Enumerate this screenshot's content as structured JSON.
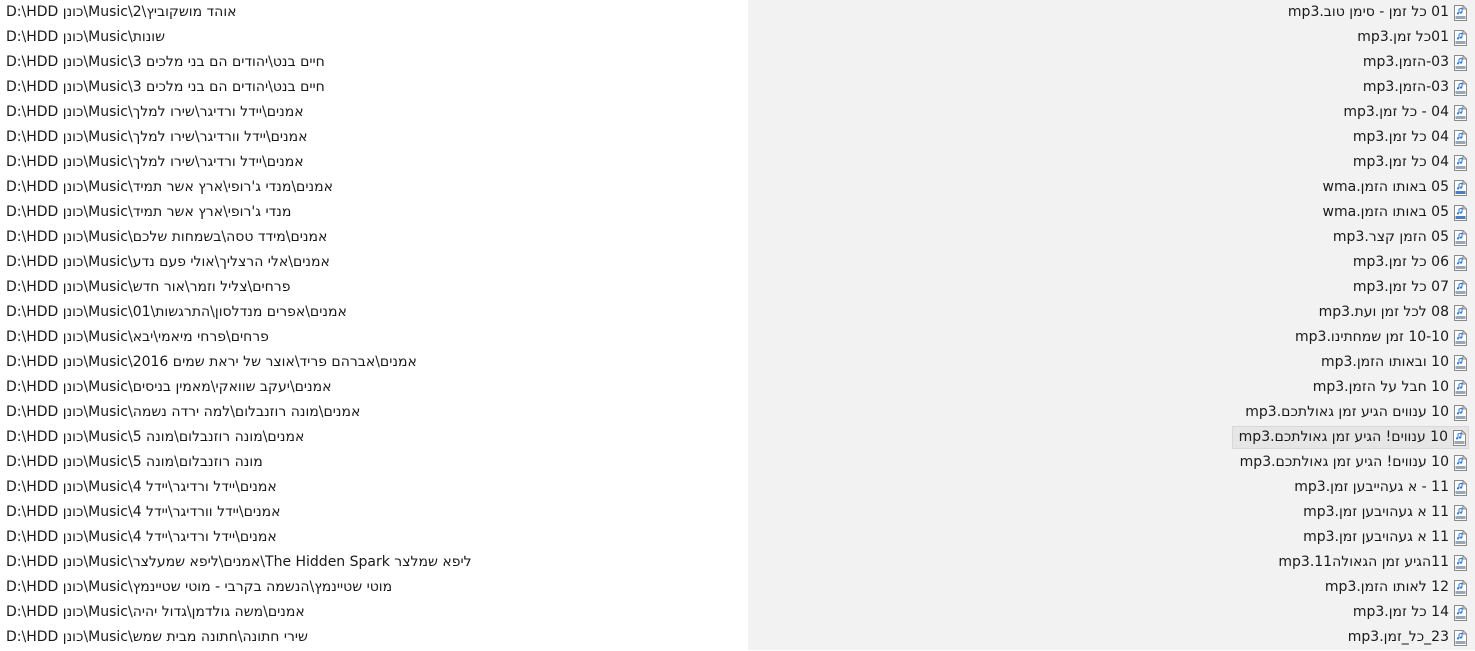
{
  "colors": {
    "path_background": "#ffffff",
    "name_background": "#f2f2f2",
    "selected_background": "#e6e6e6",
    "icon_accent": "#2e7bd6"
  },
  "icons": {
    "mp3": "mp3-file-icon",
    "wma": "wma-file-icon"
  },
  "rows": [
    {
      "name": "01 כל זמן - סימן טוב.mp3",
      "path": "D:\\HDD כונן\\Music\\אוהד מושקוביץ\\2",
      "type": "mp3",
      "selected": false
    },
    {
      "name": "01כל זמן.mp3",
      "path": "D:\\HDD כונן\\Music\\שונות",
      "type": "mp3",
      "selected": false
    },
    {
      "name": "03-הזמן.mp3",
      "path": "D:\\HDD כונן\\Music\\חיים בנט\\יהודים הם בני מלכים 3",
      "type": "mp3",
      "selected": false
    },
    {
      "name": "03-הזמן.mp3",
      "path": "D:\\HDD כונן\\Music\\חיים בנט\\יהודים הם בני מלכים 3",
      "type": "mp3",
      "selected": false
    },
    {
      "name": "04 - כל זמן.mp3",
      "path": "D:\\HDD כונן\\Music\\אמנים\\יידל ורדיגר\\שירו למלך",
      "type": "mp3",
      "selected": false
    },
    {
      "name": "04 כל זמן.mp3",
      "path": "D:\\HDD כונן\\Music\\אמנים\\יידל וורדיגר\\שירו למלך",
      "type": "mp3",
      "selected": false
    },
    {
      "name": "04 כל זמן.mp3",
      "path": "D:\\HDD כונן\\Music\\אמנים\\יידל ורדיגר\\שירו למלך",
      "type": "mp3",
      "selected": false
    },
    {
      "name": "05 באותו הזמן.wma",
      "path": "D:\\HDD כונן\\Music\\אמנים\\מנדי ג'רופי\\ארץ אשר תמיד",
      "type": "wma",
      "selected": false
    },
    {
      "name": "05 באותו הזמן.wma",
      "path": "D:\\HDD כונן\\Music\\מנדי ג'רופי\\ארץ אשר תמיד",
      "type": "wma",
      "selected": false
    },
    {
      "name": "05 הזמן קצר.mp3",
      "path": "D:\\HDD כונן\\Music\\אמנים\\מידד טסה\\בשמחות שלכם",
      "type": "mp3",
      "selected": false
    },
    {
      "name": "06 כל זמן.mp3",
      "path": "D:\\HDD כונן\\Music\\אמנים\\אלי הרצליך\\אולי פעם נדע",
      "type": "mp3",
      "selected": false
    },
    {
      "name": "07 כל זמן.mp3",
      "path": "D:\\HDD כונן\\Music\\פרחים\\צליל וזמר\\אור חדש",
      "type": "mp3",
      "selected": false
    },
    {
      "name": "08 לכל זמן ועת.mp3",
      "path": "D:\\HDD כונן\\Music\\אמנים\\אפרים מנדלסון\\התרגשות\\01",
      "type": "mp3",
      "selected": false
    },
    {
      "name": "10-10 זמן שמחתינו.mp3",
      "path": "D:\\HDD כונן\\Music\\פרחים\\פרחי מיאמי\\יבא",
      "type": "mp3",
      "selected": false
    },
    {
      "name": "10 ובאותו הזמן.mp3",
      "path": "D:\\HDD כונן\\Music\\אמנים\\אברהם פריד\\אוצר של יראת שמים 2016",
      "type": "mp3",
      "selected": false
    },
    {
      "name": "10 חבל על הזמן.mp3",
      "path": "D:\\HDD כונן\\Music\\אמנים\\יעקב שוואקי\\מאמין בניסים",
      "type": "mp3",
      "selected": false
    },
    {
      "name": "10 ענווים הגיע זמן גאולתכם.mp3",
      "path": "D:\\HDD כונן\\Music\\אמנים\\מונה רוזנבלום\\למה ירדה נשמה",
      "type": "mp3",
      "selected": false
    },
    {
      "name": "10 ענווים! הגיע זמן גאולתכם.mp3",
      "path": "D:\\HDD כונן\\Music\\אמנים\\מונה רוזנבלום\\מונה 5",
      "type": "mp3",
      "selected": true
    },
    {
      "name": "10 ענווים! הגיע זמן גאולתכם.mp3",
      "path": "D:\\HDD כונן\\Music\\מונה רוזנבלום\\מונה 5",
      "type": "mp3",
      "selected": false
    },
    {
      "name": "11 - א געהייבען זמן.mp3",
      "path": "D:\\HDD כונן\\Music\\אמנים\\יידל ורדיגר\\יידל 4",
      "type": "mp3",
      "selected": false
    },
    {
      "name": "11 א געהויבען זמן.mp3",
      "path": "D:\\HDD כונן\\Music\\אמנים\\יידל וורדיגר\\יידל 4",
      "type": "mp3",
      "selected": false
    },
    {
      "name": "11 א געהויבען זמן.mp3",
      "path": "D:\\HDD כונן\\Music\\אמנים\\יידל ורדיגר\\יידל 4",
      "type": "mp3",
      "selected": false
    },
    {
      "name": "11הגיע זמן הגאולה11.mp3",
      "path": "D:\\HDD כונן\\Music\\אמנים\\ליפא שמעלצר\\The Hidden Spark  ליפא שמלצר",
      "type": "mp3",
      "selected": false
    },
    {
      "name": "12 לאותו הזמן.mp3",
      "path": "D:\\HDD כונן\\Music\\מוטי שטיינמץ\\הנשמה בקרבי - מוטי שטיינמץ",
      "type": "mp3",
      "selected": false
    },
    {
      "name": "14 כל זמן.mp3",
      "path": "D:\\HDD כונן\\Music\\אמנים\\משה גולדמן\\גדול יהיה",
      "type": "mp3",
      "selected": false
    },
    {
      "name": "23_כל_זמן.mp3",
      "path": "D:\\HDD כונן\\Music\\שירי חתונה\\חתונה מבית שמש",
      "type": "mp3",
      "selected": false
    }
  ]
}
